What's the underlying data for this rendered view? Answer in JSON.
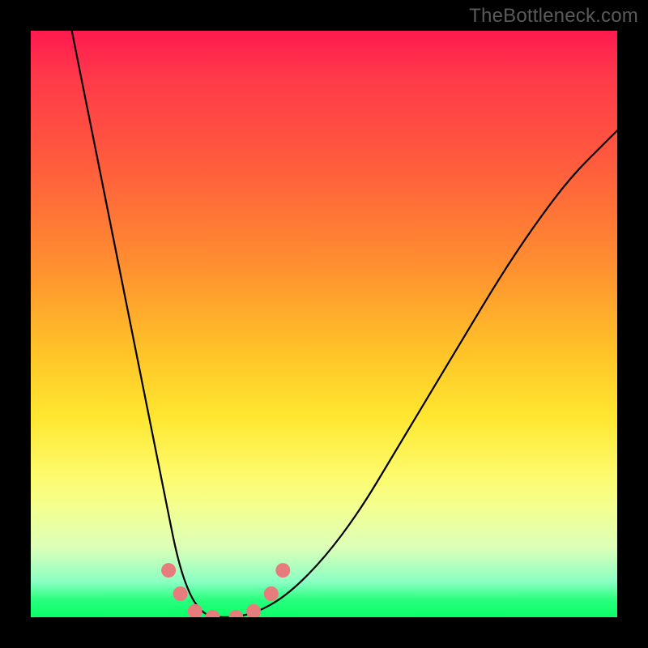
{
  "watermark": "TheBottleneck.com",
  "chart_data": {
    "type": "line",
    "title": "",
    "xlabel": "",
    "ylabel": "",
    "xlim": [
      0,
      100
    ],
    "ylim": [
      0,
      100
    ],
    "grid": false,
    "legend": false,
    "series": [
      {
        "name": "bottleneck-curve",
        "x": [
          7,
          10,
          13,
          16,
          19,
          21,
          23,
          25,
          27,
          29,
          31,
          35,
          39,
          44,
          50,
          56,
          62,
          68,
          74,
          80,
          86,
          92,
          98,
          100
        ],
        "values": [
          100,
          85,
          70,
          55,
          40,
          30,
          20,
          10,
          4,
          1,
          0,
          0,
          1,
          4,
          10,
          18,
          28,
          38,
          48,
          58,
          67,
          75,
          81,
          83
        ]
      }
    ],
    "markers": [
      {
        "x": 23.5,
        "y": 8
      },
      {
        "x": 25.5,
        "y": 4
      },
      {
        "x": 28.0,
        "y": 1
      },
      {
        "x": 31.0,
        "y": 0
      },
      {
        "x": 35.0,
        "y": 0
      },
      {
        "x": 38.0,
        "y": 1
      },
      {
        "x": 41.0,
        "y": 4
      },
      {
        "x": 43.0,
        "y": 8
      }
    ],
    "background_gradient": {
      "top": "#ff1a4f",
      "bottom": "#0aff68"
    }
  }
}
